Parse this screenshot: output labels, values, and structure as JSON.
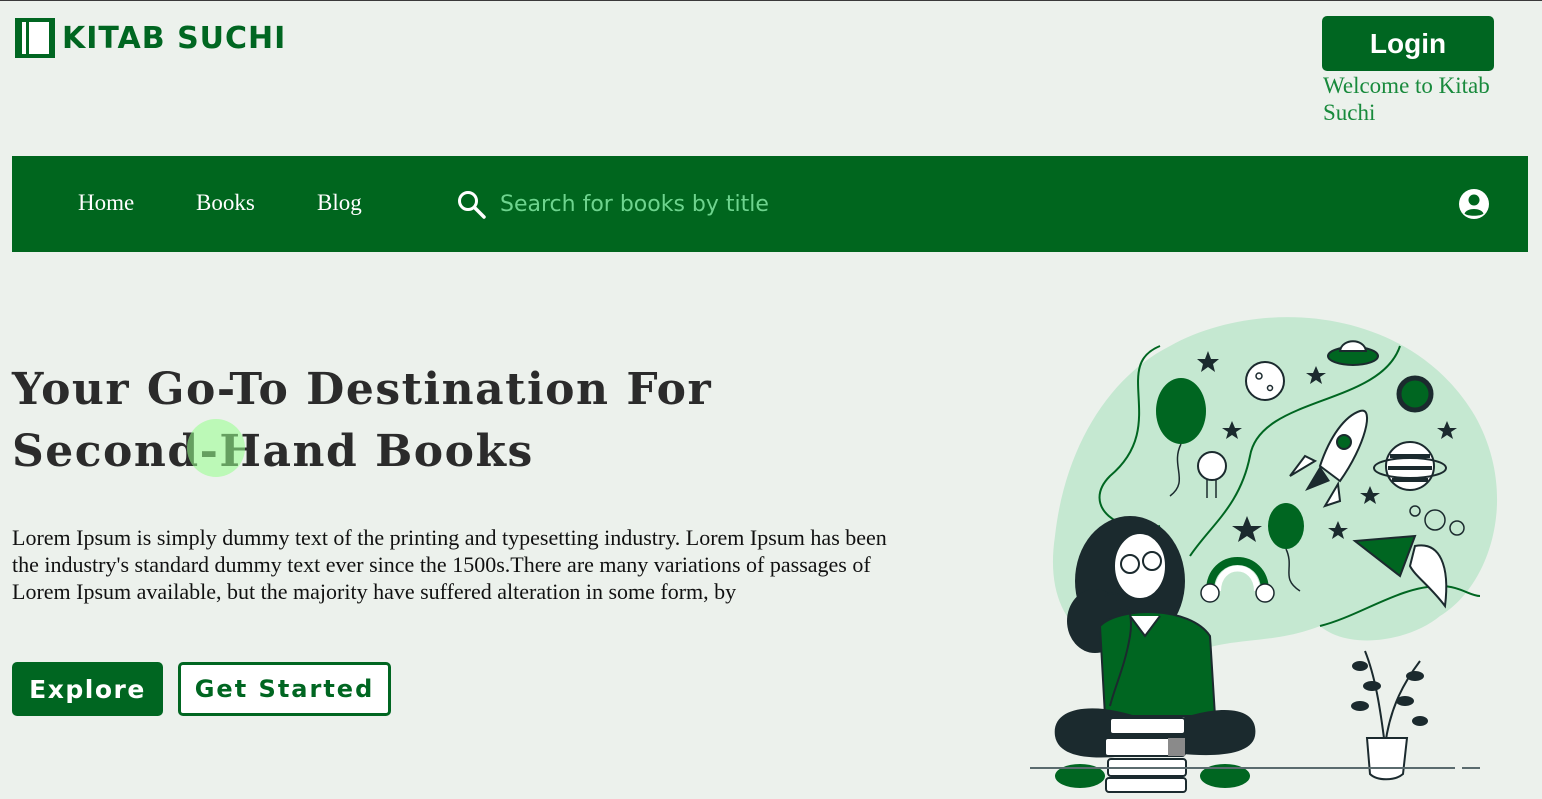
{
  "brand": {
    "name": "KITAB SUCHI",
    "icon": "book-icon",
    "color": "#006621"
  },
  "header": {
    "login_label": "Login",
    "welcome_text": "Welcome to Kitab Suchi"
  },
  "nav": {
    "items": [
      {
        "label": "Home"
      },
      {
        "label": "Books"
      },
      {
        "label": "Blog"
      }
    ],
    "search": {
      "placeholder": "Search for books by title",
      "value": "",
      "icon": "search-icon"
    },
    "account_icon": "user-circle-icon",
    "background": "#00661e"
  },
  "hero": {
    "title": "Your Go-To Destination For Second-Hand Books",
    "description": "Lorem Ipsum is simply dummy text of the printing and typesetting industry. Lorem Ipsum has been the industry's standard dummy text ever since the 1500s.There are many variations of passages of Lorem Ipsum available, but the majority have suffered alteration in some form, by",
    "explore_label": "Explore",
    "get_started_label": "Get Started",
    "illustration": "reading-girl-illustration"
  }
}
